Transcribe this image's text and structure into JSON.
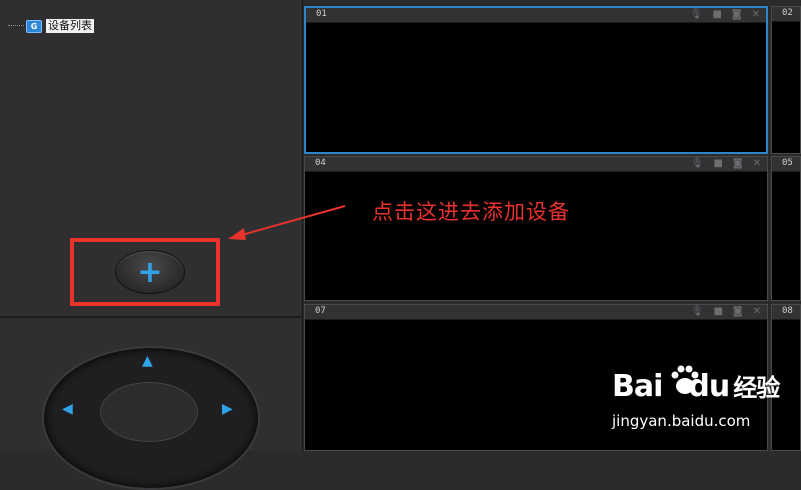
{
  "device_tree": {
    "root_icon": "folder-icon",
    "root_badge": "G",
    "root_label": "设备列表"
  },
  "add_button": {
    "label": "+"
  },
  "ptz": {
    "up": "▲",
    "left": "◀",
    "right": "▶"
  },
  "cells": [
    {
      "num": "01"
    },
    {
      "num": "02"
    },
    {
      "num": "04"
    },
    {
      "num": "05"
    },
    {
      "num": "07"
    },
    {
      "num": "08"
    }
  ],
  "cell_icons": [
    "microphone-icon",
    "video-camera-icon",
    "camera-icon",
    "close-icon"
  ],
  "cell_icon_glyphs": {
    "mic": "🎙",
    "video": "■",
    "snap": "◙",
    "close": "✕"
  },
  "annotation": {
    "text": "点击这进去添加设备",
    "color": "#e8322b"
  },
  "watermark": {
    "brand_left": "Bai",
    "brand_right": "du",
    "brand_suffix": "经验",
    "url": "jingyan.baidu.com"
  },
  "colors": {
    "accent": "#2ea3e8",
    "highlight": "#e8322b",
    "selected_border": "#2d86c7"
  }
}
